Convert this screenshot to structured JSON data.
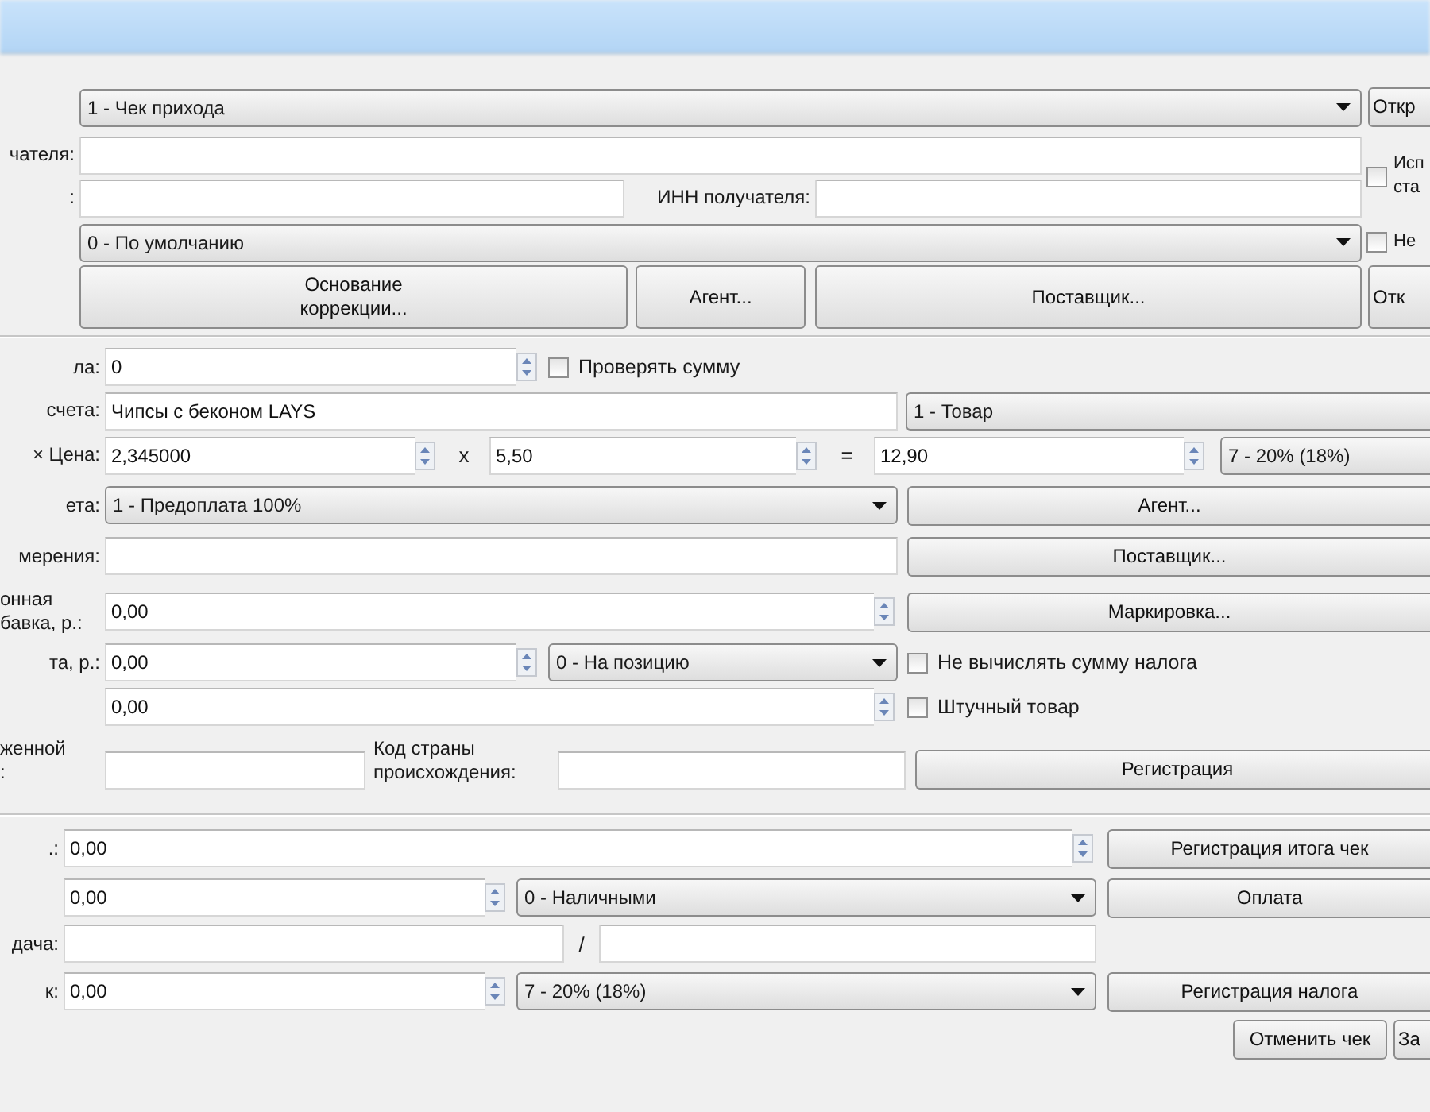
{
  "receipt": {
    "type": "1 - Чек прихода",
    "open_button": "Откр",
    "recipient_label": "чателя:",
    "source_checkbox": {
      "label": "Исп\nста",
      "checked": false
    },
    "row3_label": ":",
    "inn_label": "ИНН получателя:",
    "tax_system": "0 - По умолчанию",
    "no_print_checkbox": {
      "label": "Не",
      "checked": false
    },
    "buttons": [
      "Основание\nкоррекции...",
      "Агент...",
      "Поставщик...",
      "Отк"
    ]
  },
  "position": {
    "quantity_label": "ла:",
    "quantity": "0",
    "check_sum": {
      "label": "Проверять сумму",
      "checked": false
    },
    "name_label": "счета:",
    "name": "Чипсы с беконом LAYS",
    "object": "1 - Товар",
    "price_label": "× Цена:",
    "qty": "2,345000",
    "times": "x",
    "price": "5,50",
    "equals": "=",
    "sum": "12,90",
    "tax": "7 - 20% (18%)",
    "method_label": "ета:",
    "method": "1 - Предоплата 100%",
    "agent_button": "Агент...",
    "unit_label": "мерения:",
    "supplier_button": "Поставщик...",
    "excise_label": "онная\nбавка, р.:",
    "excise": "0,00",
    "marking_button": "Маркировка...",
    "discount_label": "та, р.:",
    "discount": "0,00",
    "discount_type": "0 - На позицию",
    "no_tax_sum": {
      "label": "Не вычислять сумму налога",
      "checked": false
    },
    "tax_sum": "0,00",
    "piece": {
      "label": "Штучный товар",
      "checked": false
    },
    "declaration_label": "женной\n:",
    "country_label": "Код страны\nпроисхождения:",
    "register_button": "Регистрация"
  },
  "totals": {
    "total_label": ".:",
    "total": "0,00",
    "total_button": "Регистрация итога чек",
    "payment": "0,00",
    "payment_type": "0 - Наличными",
    "payment_button": "Оплата",
    "change_label": "дача:",
    "slash": "/",
    "tax_label": "к:",
    "tax_sum": "0,00",
    "tax_type": "7 - 20% (18%)",
    "tax_button": "Регистрация налога",
    "cancel_button": "Отменить чек",
    "close_button": "За"
  }
}
